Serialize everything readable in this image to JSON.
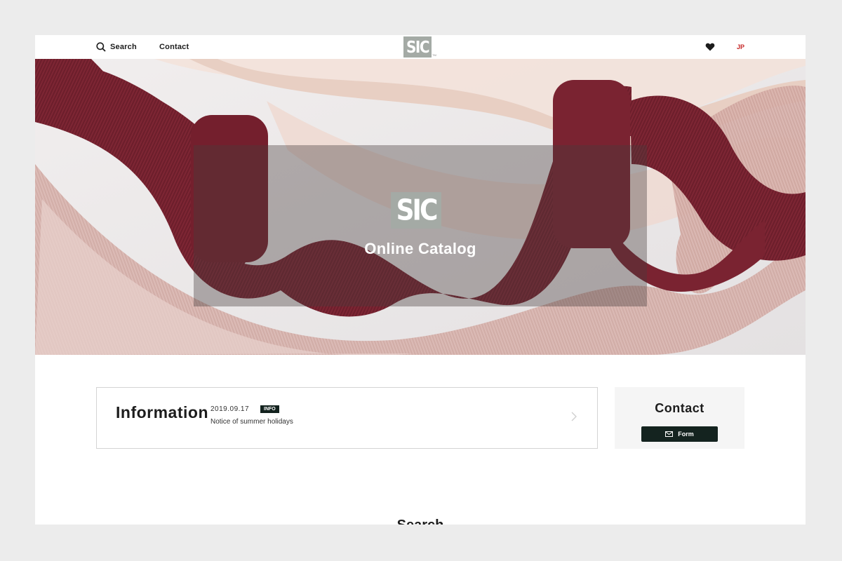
{
  "header": {
    "search_label": "Search",
    "contact_label": "Contact",
    "logo_text": "SIC",
    "logo_tm": "TM",
    "favorites_icon": "heart-icon",
    "language": "JP"
  },
  "hero": {
    "logo_text": "SIC",
    "title": "Online Catalog"
  },
  "information": {
    "title": "Information",
    "date": "2019.09.17",
    "badge": "INFO",
    "text": "Notice of summer holidays"
  },
  "contact": {
    "title": "Contact",
    "form_label": "Form"
  },
  "next_section_title": "Search",
  "colors": {
    "brand_dark": "#14231f",
    "logo_grey": "#a4aaa5",
    "lang_red": "#c62828"
  }
}
